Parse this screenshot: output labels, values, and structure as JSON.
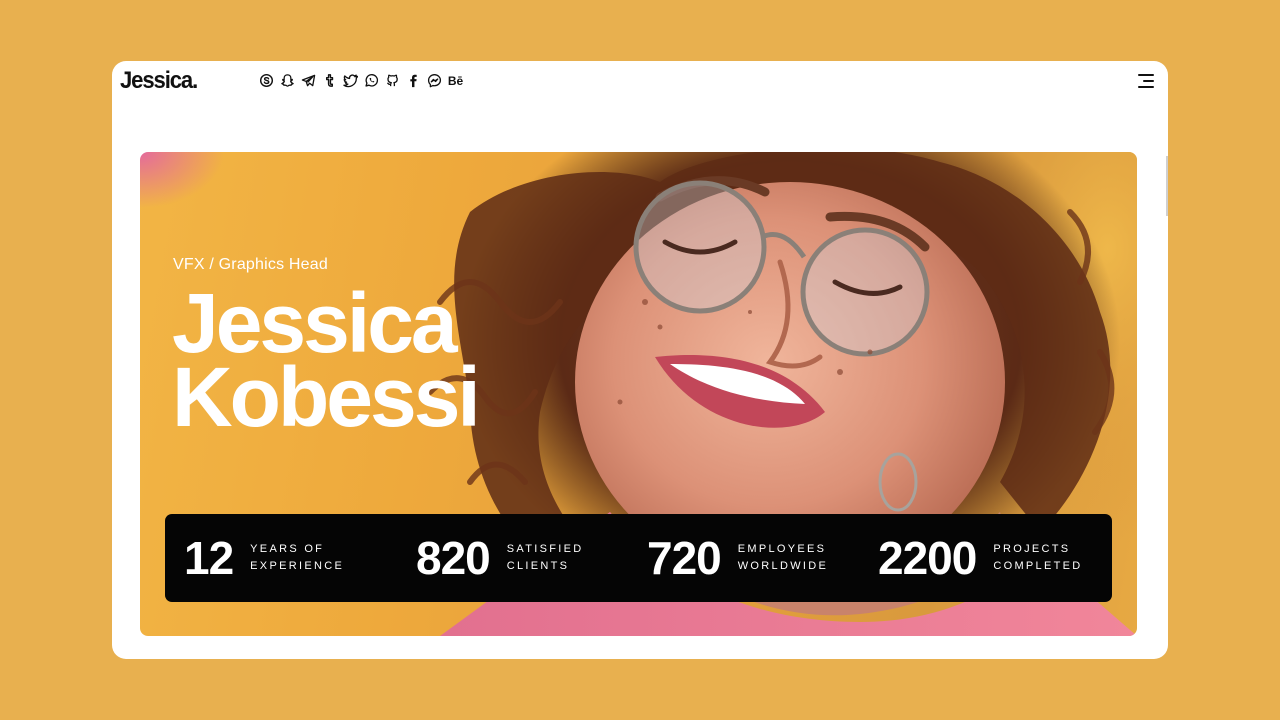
{
  "header": {
    "logo": "Jessica.",
    "social_icons": [
      {
        "name": "skype-icon"
      },
      {
        "name": "snapchat-icon"
      },
      {
        "name": "telegram-icon"
      },
      {
        "name": "tumblr-icon"
      },
      {
        "name": "twitter-icon"
      },
      {
        "name": "whatsapp-icon"
      },
      {
        "name": "github-icon"
      },
      {
        "name": "facebook-icon"
      },
      {
        "name": "messenger-icon"
      },
      {
        "name": "behance-icon",
        "text": "Bē"
      }
    ],
    "menu_icon": "hamburger-menu-icon"
  },
  "hero": {
    "role": "VFX / Graphics Head",
    "first_name": "Jessica",
    "last_name": "Kobessi"
  },
  "stats": [
    {
      "number": "12",
      "line1": "YEARS OF",
      "line2": "EXPERIENCE"
    },
    {
      "number": "820",
      "line1": "SATISFIED",
      "line2": "CLIENTS"
    },
    {
      "number": "720",
      "line1": "EMPLOYEES",
      "line2": "WORLDWIDE"
    },
    {
      "number": "2200",
      "line1": "PROJECTS",
      "line2": "COMPLETED"
    }
  ],
  "colors": {
    "background": "#E8B04F",
    "card": "#FFFFFF",
    "stats_bar": "#050505",
    "text_light": "#FFFFFF",
    "text_dark": "#111111"
  }
}
